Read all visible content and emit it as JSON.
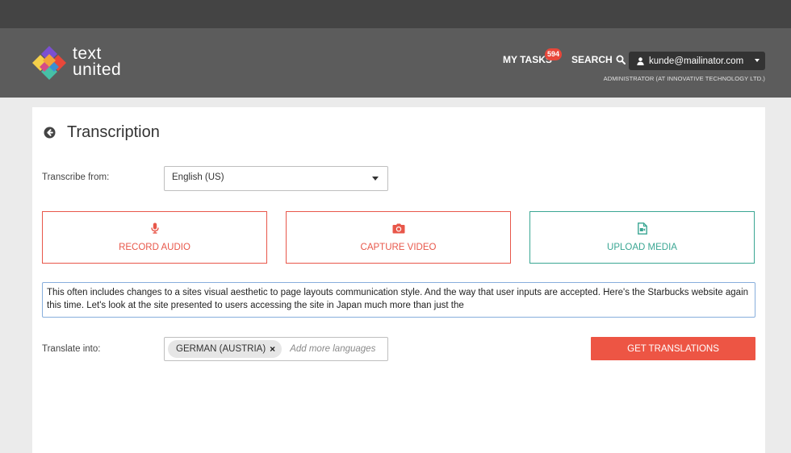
{
  "brand": {
    "line1": "text",
    "line2": "united",
    "colors": [
      "#7b4fd1",
      "#f2a33a",
      "#e8473a",
      "#46c0a6",
      "#f5d04a"
    ]
  },
  "nav": {
    "tasks_label": "MY TASKS",
    "tasks_count": "594",
    "search_label": "SEARCH",
    "user_email": "kunde@mailinator.com",
    "user_role": "ADMINISTRATOR (AT INNOVATIVE TECHNOLOGY LTD.)"
  },
  "page": {
    "title": "Transcription",
    "transcribe_from_label": "Transcribe from:",
    "source_language": "English (US)",
    "media_buttons": {
      "record": "RECORD AUDIO",
      "capture": "CAPTURE VIDEO",
      "upload": "UPLOAD MEDIA"
    },
    "transcript_text": "This often includes changes to a sites visual aesthetic to page layouts communication style. And the way that user inputs are accepted. Here's the Starbucks website again this time. Let's look at the site presented to users accessing the site in Japan much more than just the",
    "translate_into_label": "Translate into:",
    "selected_language": "GERMAN (AUSTRIA)",
    "remove_symbol": "×",
    "add_languages_placeholder": "Add more languages",
    "get_translations_label": "GET TRANSLATIONS"
  },
  "icons": {
    "back": "back-arrow-circle-icon",
    "search": "search-icon",
    "user": "user-icon",
    "record": "microphone-icon",
    "capture": "camera-icon",
    "upload": "video-file-icon"
  },
  "colors": {
    "accent": "#ed5544",
    "teal": "#3aa693",
    "header": "#5c5c5c",
    "topbar": "#444444",
    "badge": "#e8473a"
  }
}
